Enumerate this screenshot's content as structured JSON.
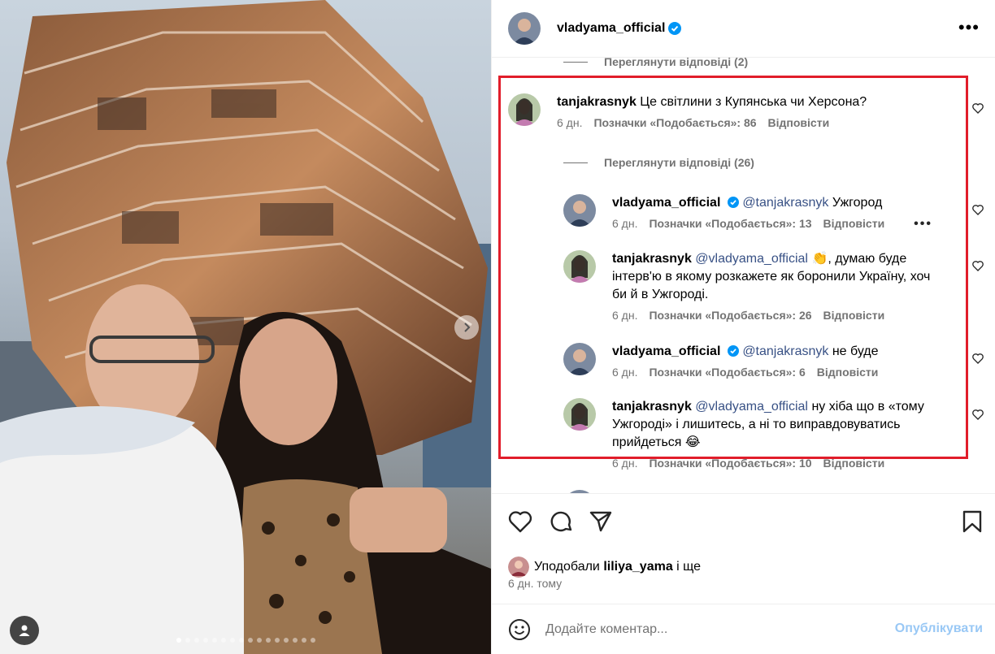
{
  "post": {
    "author": "vladyama_official",
    "more_icon": "more-horizontal-icon",
    "likes_prefix": "Уподобали",
    "likes_user": "liliya_yama",
    "likes_suffix": "і ще",
    "time": "6 дн. тому"
  },
  "comments_panel": {
    "top_view_replies": "Переглянути відповіді (2)",
    "main_comment": {
      "author": "tanjakrasnyk",
      "text": "Це світлини з Купянська чи Херсона?",
      "time": "6 дн.",
      "likes": "Позначки «Подобається»: 86",
      "reply": "Відповісти"
    },
    "view_replies": "Переглянути відповіді (26)",
    "replies": [
      {
        "author": "vladyama_official",
        "mention": "@tanjakrasnyk",
        "text": "Ужгород",
        "time": "6 дн.",
        "likes": "Позначки «Подобається»: 13",
        "reply": "Відповісти"
      },
      {
        "author": "tanjakrasnyk",
        "mention": "@vladyama_official",
        "text": "👏, думаю буде інтерв'ю в якому розкажете як боронили Україну, хоч би й в Ужгороді.",
        "time": "6 дн.",
        "likes": "Позначки «Подобається»: 26",
        "reply": "Відповісти"
      },
      {
        "author": "vladyama_official",
        "mention": "@tanjakrasnyk",
        "text": "не буде",
        "time": "6 дн.",
        "likes": "Позначки «Подобається»: 6",
        "reply": "Відповісти"
      },
      {
        "author": "tanjakrasnyk",
        "mention": "@vladyama_official",
        "text": "ну хіба що в «тому Ужгороді» і лишитесь, а ні то виправдовуватись прийдеться 😂",
        "time": "6 дн.",
        "likes": "Позначки «Подобається»: 10",
        "reply": "Відповісти"
      }
    ]
  },
  "add_comment": {
    "placeholder": "Додайте коментар...",
    "publish_label": "Опублікувати"
  },
  "carousel": {
    "total_dots": 16,
    "active_index": 0
  },
  "colors": {
    "highlight": "#e11d2a",
    "verified": "#0095f6",
    "mention": "#385185",
    "muted": "#737373"
  }
}
